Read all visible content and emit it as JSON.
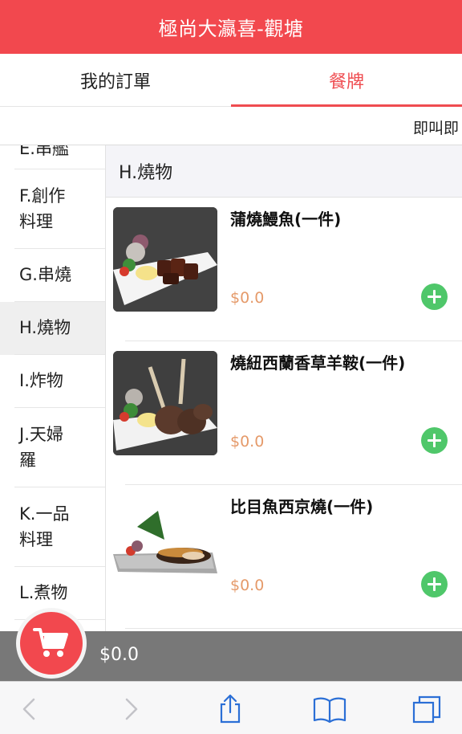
{
  "header": {
    "title": "極尚大瀛喜-觀塘"
  },
  "tabs": [
    {
      "label": "我的訂單",
      "active": false
    },
    {
      "label": "餐牌",
      "active": true
    }
  ],
  "notice": {
    "text": "即叫即"
  },
  "sidebar": {
    "items": [
      {
        "label": "E.串艦"
      },
      {
        "label": "F.創作\n料理"
      },
      {
        "label": "G.串燒"
      },
      {
        "label": "H.燒物",
        "active": true
      },
      {
        "label": "I.炸物"
      },
      {
        "label": "J.天婦\n羅"
      },
      {
        "label": "K.一品\n料理"
      },
      {
        "label": "L.煮物"
      }
    ]
  },
  "section": {
    "title": "H.燒物"
  },
  "items": [
    {
      "name": "蒲燒鰻魚(一件)",
      "price": "$0.0",
      "image_icon": "grilled-eel-photo"
    },
    {
      "name": "燒紐西蘭香草羊鞍(一件)",
      "price": "$0.0",
      "image_icon": "lamb-rack-photo"
    },
    {
      "name": "比目魚西京燒(一件)",
      "price": "$0.0",
      "image_icon": "grilled-fish-photo"
    }
  ],
  "cart": {
    "total": "$0.0"
  },
  "toolbar": {
    "icons": [
      "back-icon",
      "forward-icon",
      "share-icon",
      "bookmarks-icon",
      "tabs-icon"
    ]
  },
  "colors": {
    "brand": "#f2484e",
    "add": "#4fc76a",
    "price": "#e59a6a",
    "cartbar": "#787878"
  }
}
